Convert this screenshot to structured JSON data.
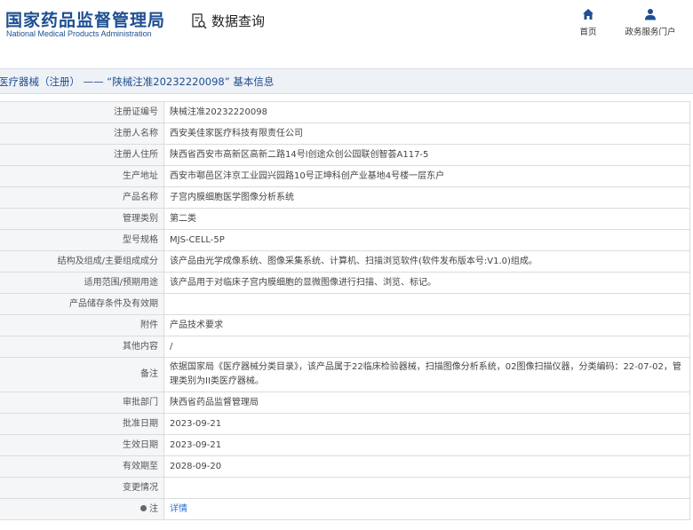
{
  "header": {
    "logo_cn": "国家药品监督管理局",
    "logo_en": "National Medical Products Administration",
    "query_label": "数据查询",
    "nav": [
      {
        "label": "首页",
        "icon": "home-icon"
      },
      {
        "label": "政务服务门户",
        "icon": "user-icon"
      }
    ]
  },
  "title_bar": {
    "text": "医疗器械（注册） —— “陕械注准20232220098” 基本信息"
  },
  "rows": [
    {
      "label": "注册证编号",
      "value": "陕械注准20232220098"
    },
    {
      "label": "注册人名称",
      "value": "西安美佳家医疗科技有限责任公司"
    },
    {
      "label": "注册人住所",
      "value": "陕西省西安市高新区高新二路14号l创途众创公园联创智荟A117-5"
    },
    {
      "label": "生产地址",
      "value": "西安市鄠邑区沣京工业园兴园路10号正坤科创产业基地4号楼一层东户"
    },
    {
      "label": "产品名称",
      "value": "子宫内膜细胞医学图像分析系统"
    },
    {
      "label": "管理类别",
      "value": "第二类"
    },
    {
      "label": "型号规格",
      "value": "MJS-CELL-5P"
    },
    {
      "label": "结构及组成/主要组成成分",
      "value": "该产品由光学成像系统、图像采集系统、计算机、扫描浏览软件(软件发布版本号:V1.0)组成。"
    },
    {
      "label": "适用范围/预期用途",
      "value": "该产品用于对临床子宫内膜细胞的显微图像进行扫描、浏览、标记。"
    },
    {
      "label": "产品储存条件及有效期",
      "value": ""
    },
    {
      "label": "附件",
      "value": "产品技术要求"
    },
    {
      "label": "其他内容",
      "value": "/"
    },
    {
      "label": "备注",
      "value": "依据国家局《医疗器械分类目录》，该产品属于22临床检验器械，扫描图像分析系统，02图像扫描仪器，分类编码：22-07-02，管理类别为II类医疗器械。",
      "tall": true
    },
    {
      "label": "审批部门",
      "value": "陕西省药品监督管理局"
    },
    {
      "label": "批准日期",
      "value": "2023-09-21"
    },
    {
      "label": "生效日期",
      "value": "2023-09-21"
    },
    {
      "label": "有效期至",
      "value": "2028-09-20"
    },
    {
      "label": "变更情况",
      "value": ""
    }
  ],
  "note_row": {
    "label": "注",
    "link": "详情"
  }
}
